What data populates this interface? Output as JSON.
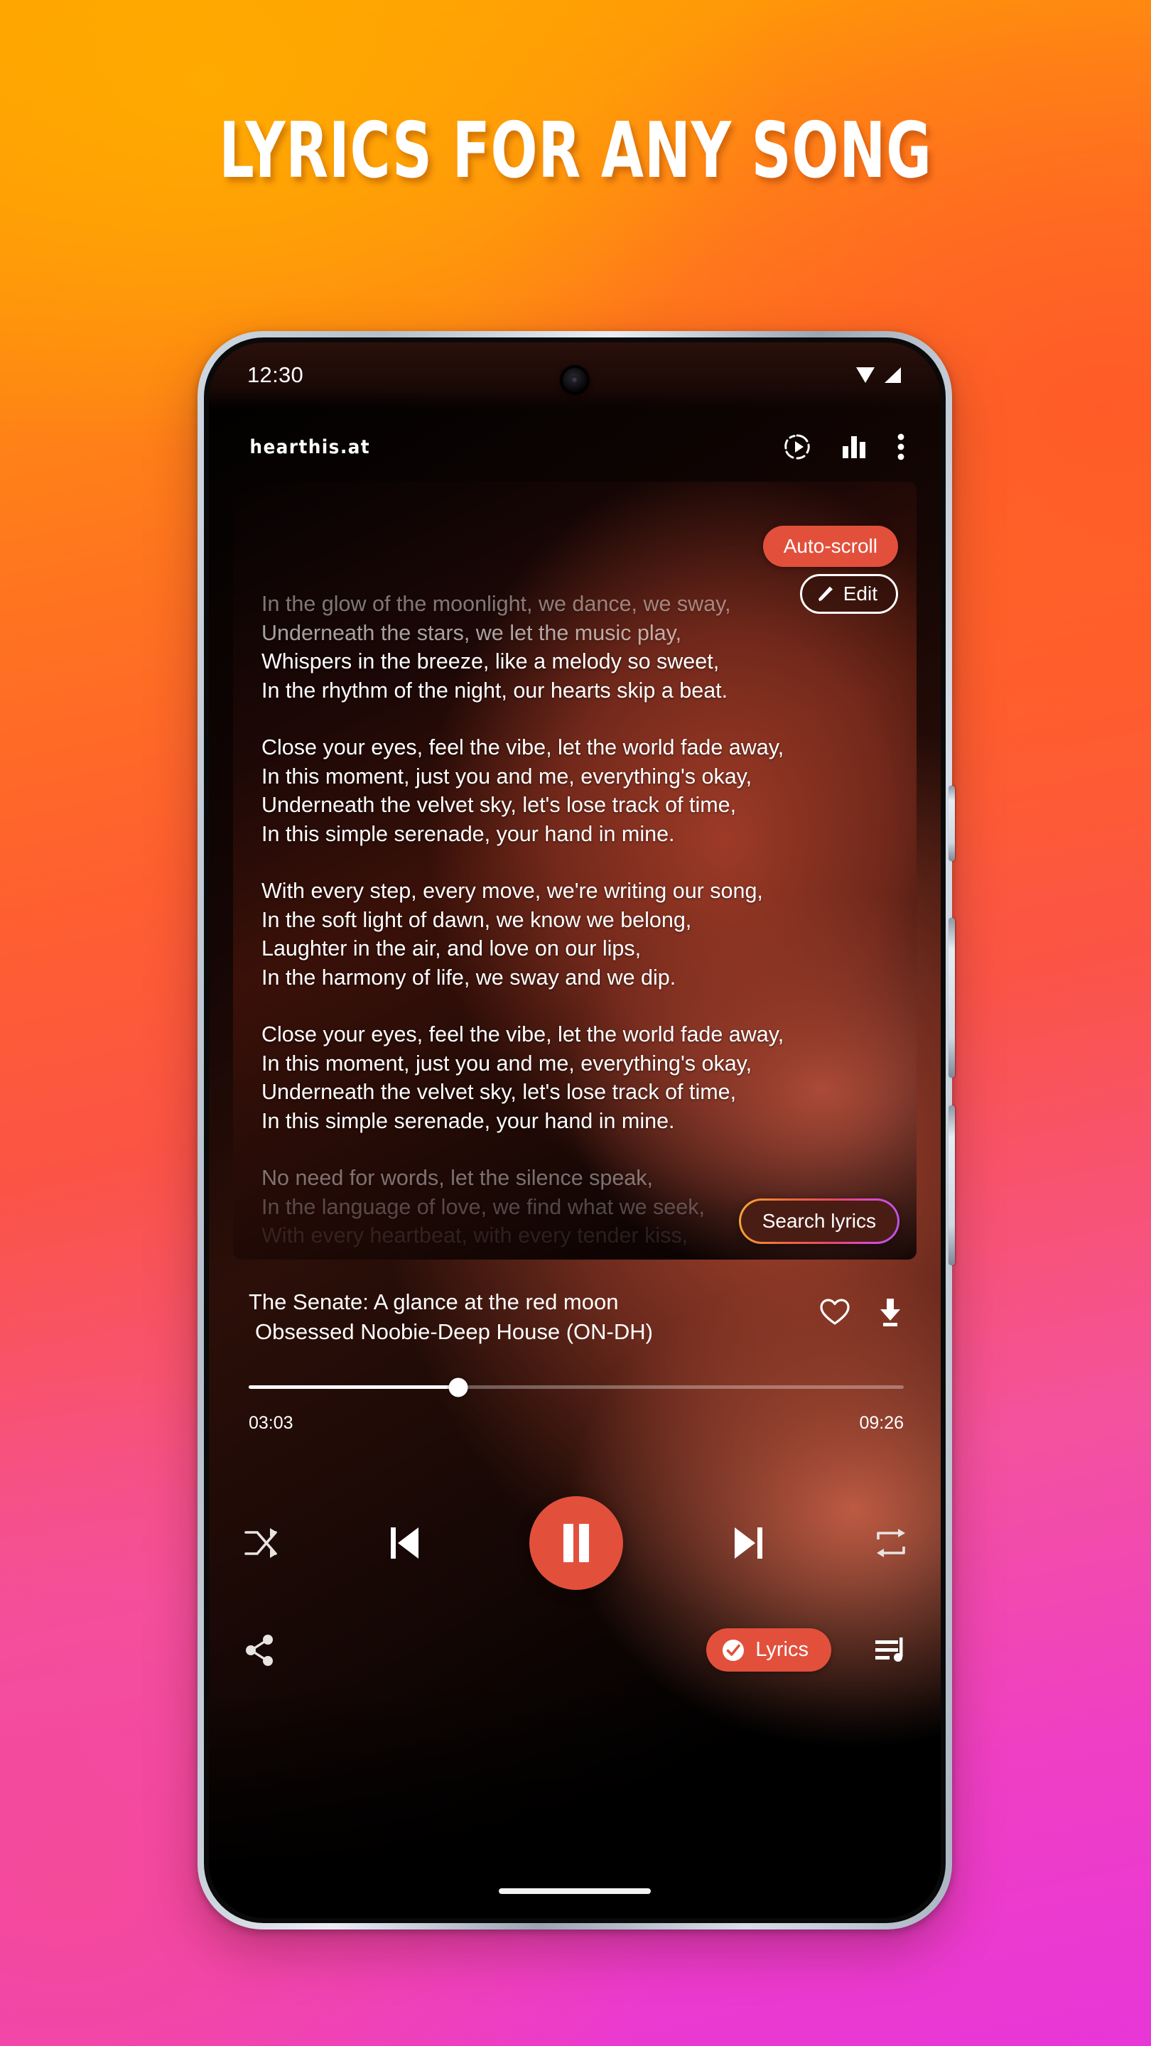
{
  "promo": {
    "headline": "LYRICS FOR ANY SONG"
  },
  "phone": {
    "statusbar": {
      "clock": "12:30",
      "wifi_icon": "wifi-icon",
      "signal_icon": "cellular-signal-icon",
      "camera": "front-camera-punchhole"
    },
    "app_header": {
      "logo_text": "hearthis.at",
      "icons": [
        {
          "name": "cast-play-icon",
          "label": "Cast"
        },
        {
          "name": "equalizer-icon",
          "label": "Equalizer"
        },
        {
          "name": "overflow-menu-icon",
          "label": "More options"
        }
      ]
    },
    "lyrics": {
      "autoscroll_label": "Auto-scroll",
      "edit_label": "Edit",
      "edit_icon": "pencil-icon",
      "search_label": "Search lyrics",
      "stanzas": [
        {
          "opacity": "faded-top",
          "lines": [
            "In the glow of the moonlight, we dance, we sway,",
            "Underneath the stars, we let the music play,",
            "Whispers in the breeze, like a melody so sweet,",
            "In the rhythm of the night, our hearts skip a beat."
          ]
        },
        {
          "opacity": "full",
          "lines": [
            "Close your eyes, feel the vibe, let the world fade away,",
            "In this moment, just you and me, everything's okay,",
            "Underneath the velvet sky, let's lose track of time,",
            "In this simple serenade, your hand in mine."
          ]
        },
        {
          "opacity": "full",
          "lines": [
            "With every step, every move, we're writing our song,",
            "In the soft light of dawn, we know we belong,",
            "Laughter in the air, and love on our lips,",
            "In the harmony of life, we sway and we dip."
          ]
        },
        {
          "opacity": "full",
          "lines": [
            "Close your eyes, feel the vibe, let the world fade away,",
            "In this moment, just you and me, everything's okay,",
            "Underneath the velvet sky, let's lose track of time,",
            "In this simple serenade, your hand in mine."
          ]
        },
        {
          "opacity": "fading-bottom",
          "lines": [
            "No need for words, let the silence speak,",
            "In the language of love, we find what we seek,",
            "With every heartbeat, with every tender kiss,"
          ]
        }
      ]
    },
    "player": {
      "track_title": "The Senate: A glance at the red moon",
      "track_artist": "Obsessed Noobie-Deep House (ON-DH)",
      "favorite_icon": "heart-outline-icon",
      "download_icon": "download-icon",
      "elapsed": "03:03",
      "duration": "09:26",
      "progress_percent": 32,
      "controls": [
        {
          "name": "shuffle-button",
          "icon": "shuffle-icon"
        },
        {
          "name": "previous-button",
          "icon": "skip-previous-icon"
        },
        {
          "name": "play-pause-button",
          "icon": "pause-icon"
        },
        {
          "name": "next-button",
          "icon": "skip-next-icon"
        },
        {
          "name": "repeat-button",
          "icon": "repeat-icon"
        }
      ]
    },
    "bottom_bar": {
      "share_icon": "share-icon",
      "lyrics_label": "Lyrics",
      "lyrics_check_icon": "check-circle-icon",
      "queue_icon": "playlist-queue-icon"
    },
    "colors": {
      "accent": "#e2503c",
      "screen_bg": "#000000",
      "text": "#ffffff"
    }
  }
}
